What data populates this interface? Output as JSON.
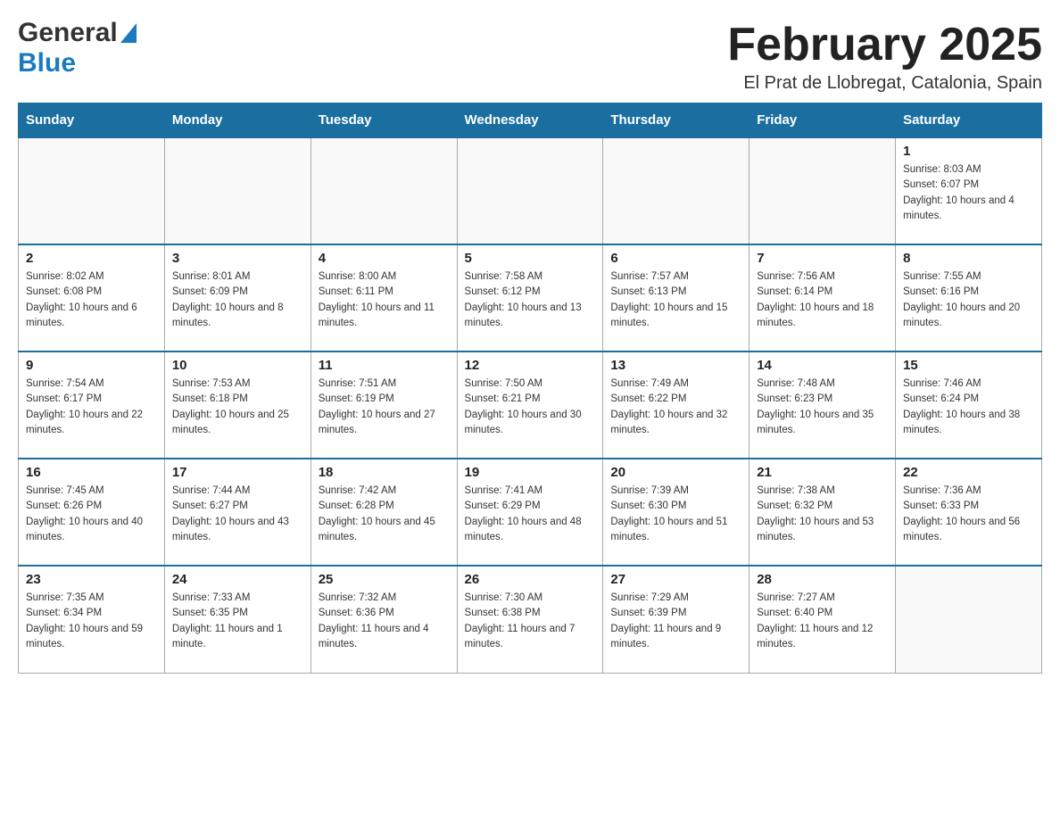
{
  "header": {
    "logo_general": "General",
    "logo_blue": "Blue",
    "title": "February 2025",
    "location": "El Prat de Llobregat, Catalonia, Spain"
  },
  "calendar": {
    "days_of_week": [
      "Sunday",
      "Monday",
      "Tuesday",
      "Wednesday",
      "Thursday",
      "Friday",
      "Saturday"
    ],
    "weeks": [
      [
        {
          "day": "",
          "info": ""
        },
        {
          "day": "",
          "info": ""
        },
        {
          "day": "",
          "info": ""
        },
        {
          "day": "",
          "info": ""
        },
        {
          "day": "",
          "info": ""
        },
        {
          "day": "",
          "info": ""
        },
        {
          "day": "1",
          "info": "Sunrise: 8:03 AM\nSunset: 6:07 PM\nDaylight: 10 hours and 4 minutes."
        }
      ],
      [
        {
          "day": "2",
          "info": "Sunrise: 8:02 AM\nSunset: 6:08 PM\nDaylight: 10 hours and 6 minutes."
        },
        {
          "day": "3",
          "info": "Sunrise: 8:01 AM\nSunset: 6:09 PM\nDaylight: 10 hours and 8 minutes."
        },
        {
          "day": "4",
          "info": "Sunrise: 8:00 AM\nSunset: 6:11 PM\nDaylight: 10 hours and 11 minutes."
        },
        {
          "day": "5",
          "info": "Sunrise: 7:58 AM\nSunset: 6:12 PM\nDaylight: 10 hours and 13 minutes."
        },
        {
          "day": "6",
          "info": "Sunrise: 7:57 AM\nSunset: 6:13 PM\nDaylight: 10 hours and 15 minutes."
        },
        {
          "day": "7",
          "info": "Sunrise: 7:56 AM\nSunset: 6:14 PM\nDaylight: 10 hours and 18 minutes."
        },
        {
          "day": "8",
          "info": "Sunrise: 7:55 AM\nSunset: 6:16 PM\nDaylight: 10 hours and 20 minutes."
        }
      ],
      [
        {
          "day": "9",
          "info": "Sunrise: 7:54 AM\nSunset: 6:17 PM\nDaylight: 10 hours and 22 minutes."
        },
        {
          "day": "10",
          "info": "Sunrise: 7:53 AM\nSunset: 6:18 PM\nDaylight: 10 hours and 25 minutes."
        },
        {
          "day": "11",
          "info": "Sunrise: 7:51 AM\nSunset: 6:19 PM\nDaylight: 10 hours and 27 minutes."
        },
        {
          "day": "12",
          "info": "Sunrise: 7:50 AM\nSunset: 6:21 PM\nDaylight: 10 hours and 30 minutes."
        },
        {
          "day": "13",
          "info": "Sunrise: 7:49 AM\nSunset: 6:22 PM\nDaylight: 10 hours and 32 minutes."
        },
        {
          "day": "14",
          "info": "Sunrise: 7:48 AM\nSunset: 6:23 PM\nDaylight: 10 hours and 35 minutes."
        },
        {
          "day": "15",
          "info": "Sunrise: 7:46 AM\nSunset: 6:24 PM\nDaylight: 10 hours and 38 minutes."
        }
      ],
      [
        {
          "day": "16",
          "info": "Sunrise: 7:45 AM\nSunset: 6:26 PM\nDaylight: 10 hours and 40 minutes."
        },
        {
          "day": "17",
          "info": "Sunrise: 7:44 AM\nSunset: 6:27 PM\nDaylight: 10 hours and 43 minutes."
        },
        {
          "day": "18",
          "info": "Sunrise: 7:42 AM\nSunset: 6:28 PM\nDaylight: 10 hours and 45 minutes."
        },
        {
          "day": "19",
          "info": "Sunrise: 7:41 AM\nSunset: 6:29 PM\nDaylight: 10 hours and 48 minutes."
        },
        {
          "day": "20",
          "info": "Sunrise: 7:39 AM\nSunset: 6:30 PM\nDaylight: 10 hours and 51 minutes."
        },
        {
          "day": "21",
          "info": "Sunrise: 7:38 AM\nSunset: 6:32 PM\nDaylight: 10 hours and 53 minutes."
        },
        {
          "day": "22",
          "info": "Sunrise: 7:36 AM\nSunset: 6:33 PM\nDaylight: 10 hours and 56 minutes."
        }
      ],
      [
        {
          "day": "23",
          "info": "Sunrise: 7:35 AM\nSunset: 6:34 PM\nDaylight: 10 hours and 59 minutes."
        },
        {
          "day": "24",
          "info": "Sunrise: 7:33 AM\nSunset: 6:35 PM\nDaylight: 11 hours and 1 minute."
        },
        {
          "day": "25",
          "info": "Sunrise: 7:32 AM\nSunset: 6:36 PM\nDaylight: 11 hours and 4 minutes."
        },
        {
          "day": "26",
          "info": "Sunrise: 7:30 AM\nSunset: 6:38 PM\nDaylight: 11 hours and 7 minutes."
        },
        {
          "day": "27",
          "info": "Sunrise: 7:29 AM\nSunset: 6:39 PM\nDaylight: 11 hours and 9 minutes."
        },
        {
          "day": "28",
          "info": "Sunrise: 7:27 AM\nSunset: 6:40 PM\nDaylight: 11 hours and 12 minutes."
        },
        {
          "day": "",
          "info": ""
        }
      ]
    ]
  }
}
